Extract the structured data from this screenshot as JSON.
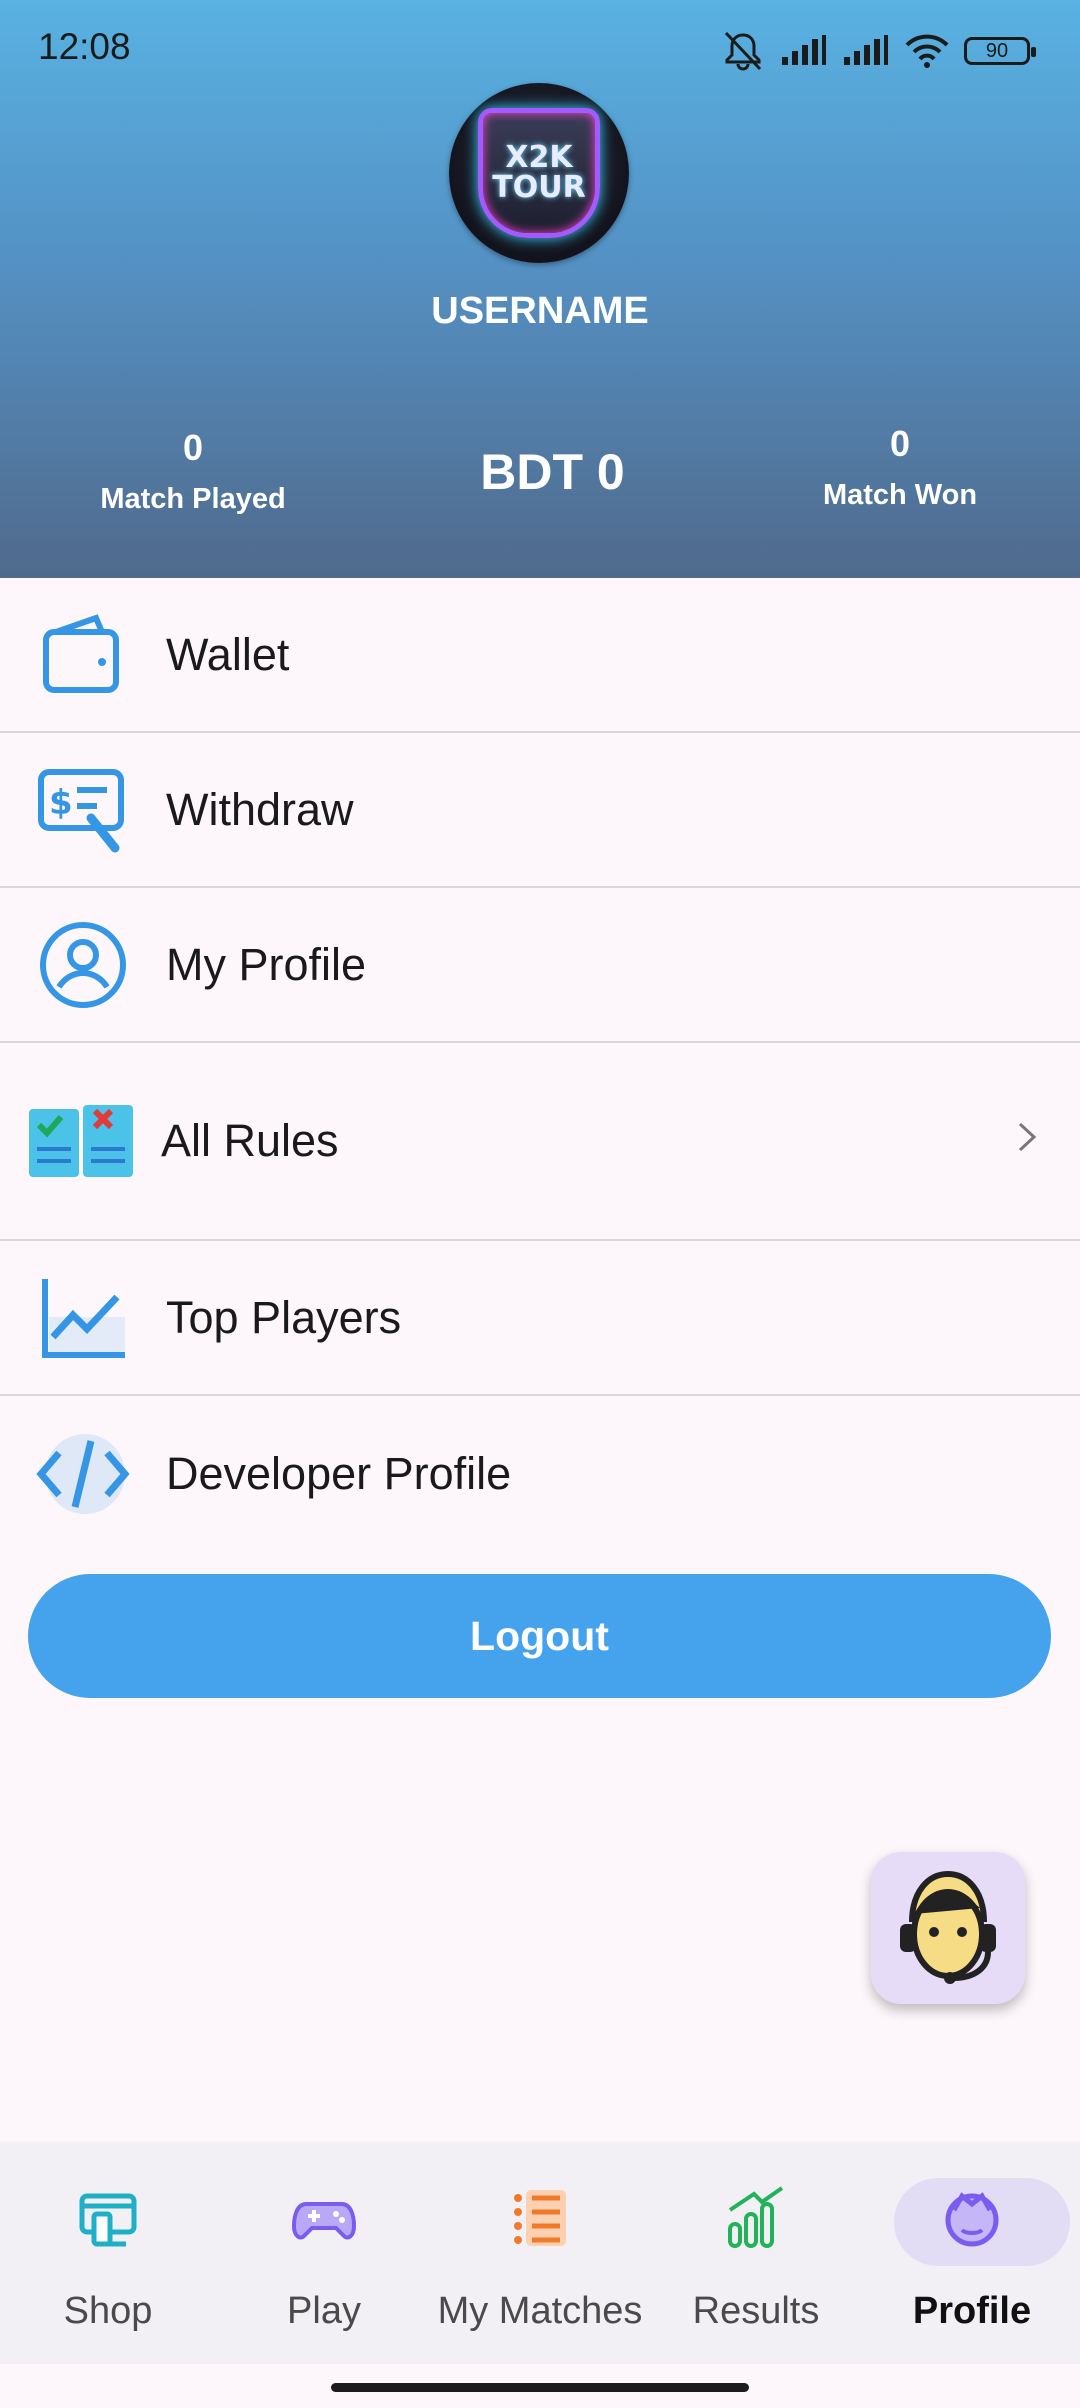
{
  "status_bar": {
    "time": "12:08",
    "battery": "90"
  },
  "profile": {
    "avatar_text_line1": "X2K",
    "avatar_text_line2": "TOUR",
    "username": "USERNAME",
    "match_played_value": "0",
    "match_played_label": "Match Played",
    "balance": "BDT 0",
    "match_won_value": "0",
    "match_won_label": "Match Won"
  },
  "menu": [
    {
      "label": "Wallet",
      "icon": "wallet-icon"
    },
    {
      "label": "Withdraw",
      "icon": "withdraw-icon"
    },
    {
      "label": "My Profile",
      "icon": "user-icon"
    },
    {
      "label": "All Rules",
      "icon": "rules-book-icon"
    },
    {
      "label": "Top Players",
      "icon": "chart-icon"
    },
    {
      "label": "Developer Profile",
      "icon": "code-icon"
    }
  ],
  "logout_label": "Logout",
  "bottom_nav": [
    {
      "label": "Shop",
      "icon": "shop-icon",
      "color": "#1fb0c8"
    },
    {
      "label": "Play",
      "icon": "gamepad-icon",
      "color": "#7a5cf0"
    },
    {
      "label": "My Matches",
      "icon": "list-icon",
      "color": "#f07a2a"
    },
    {
      "label": "Results",
      "icon": "bars-icon",
      "color": "#22b35a"
    },
    {
      "label": "Profile",
      "icon": "profile-icon",
      "color": "#7a5cf0",
      "active": true
    }
  ],
  "colors": {
    "accent": "#45a3ee",
    "header_top": "#58b2e2",
    "header_bottom": "#506a8c"
  }
}
